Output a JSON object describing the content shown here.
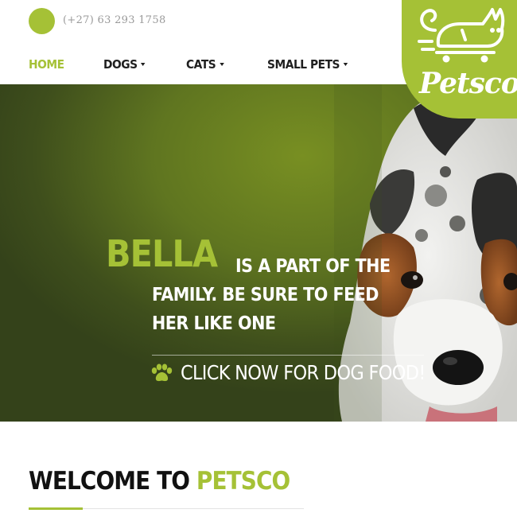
{
  "header": {
    "phone": "(+27) 63 293 1758",
    "nav": [
      {
        "label": "HOME",
        "active": true,
        "has_dropdown": false
      },
      {
        "label": "DOGS",
        "active": false,
        "has_dropdown": true
      },
      {
        "label": "CATS",
        "active": false,
        "has_dropdown": true
      },
      {
        "label": "SMALL PETS",
        "active": false,
        "has_dropdown": true
      }
    ],
    "logo_text": "Petsco"
  },
  "hero": {
    "name": "BELLA",
    "line1": "IS A PART OF THE",
    "line2": "FAMILY. BE SURE TO FEED",
    "line3": "HER LIKE ONE",
    "cta": "CLICK NOW FOR DOG FOOD!",
    "cta_icon": "paw-icon"
  },
  "welcome": {
    "prefix": "WELCOME TO ",
    "highlight": "PETSCO"
  },
  "colors": {
    "accent": "#a5c136",
    "text_dark": "#1f1f1f",
    "muted": "#9a9a9a"
  }
}
